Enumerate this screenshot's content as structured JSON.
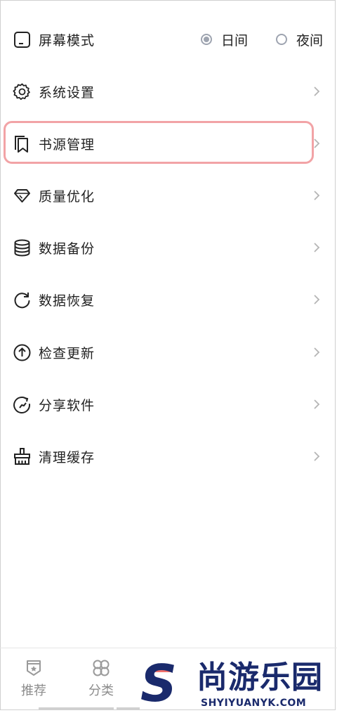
{
  "screen_mode": {
    "label": "屏幕模式",
    "options": [
      {
        "label": "日间",
        "checked": true
      },
      {
        "label": "夜间",
        "checked": false
      }
    ]
  },
  "menu": [
    {
      "label": "系统设置",
      "icon": "gear-icon"
    },
    {
      "label": "书源管理",
      "icon": "bookmark-icon",
      "highlighted": true
    },
    {
      "label": "质量优化",
      "icon": "diamond-icon"
    },
    {
      "label": "数据备份",
      "icon": "database-icon"
    },
    {
      "label": "数据恢复",
      "icon": "refresh-icon"
    },
    {
      "label": "检查更新",
      "icon": "arrow-up-circle-icon"
    },
    {
      "label": "分享软件",
      "icon": "share-icon"
    },
    {
      "label": "清理缓存",
      "icon": "broom-icon"
    }
  ],
  "bottom_nav": [
    {
      "label": "推荐",
      "icon": "badge-star-icon"
    },
    {
      "label": "分类",
      "icon": "grid-clover-icon"
    }
  ],
  "watermark": {
    "logo_letter": "S",
    "title": "尚游乐园",
    "subtitle": "SHYIYUANYK.COM"
  },
  "colors": {
    "highlight_border": "#f2a3a6",
    "radio": "#9ea4b0",
    "watermark": "#1a2a6c"
  }
}
